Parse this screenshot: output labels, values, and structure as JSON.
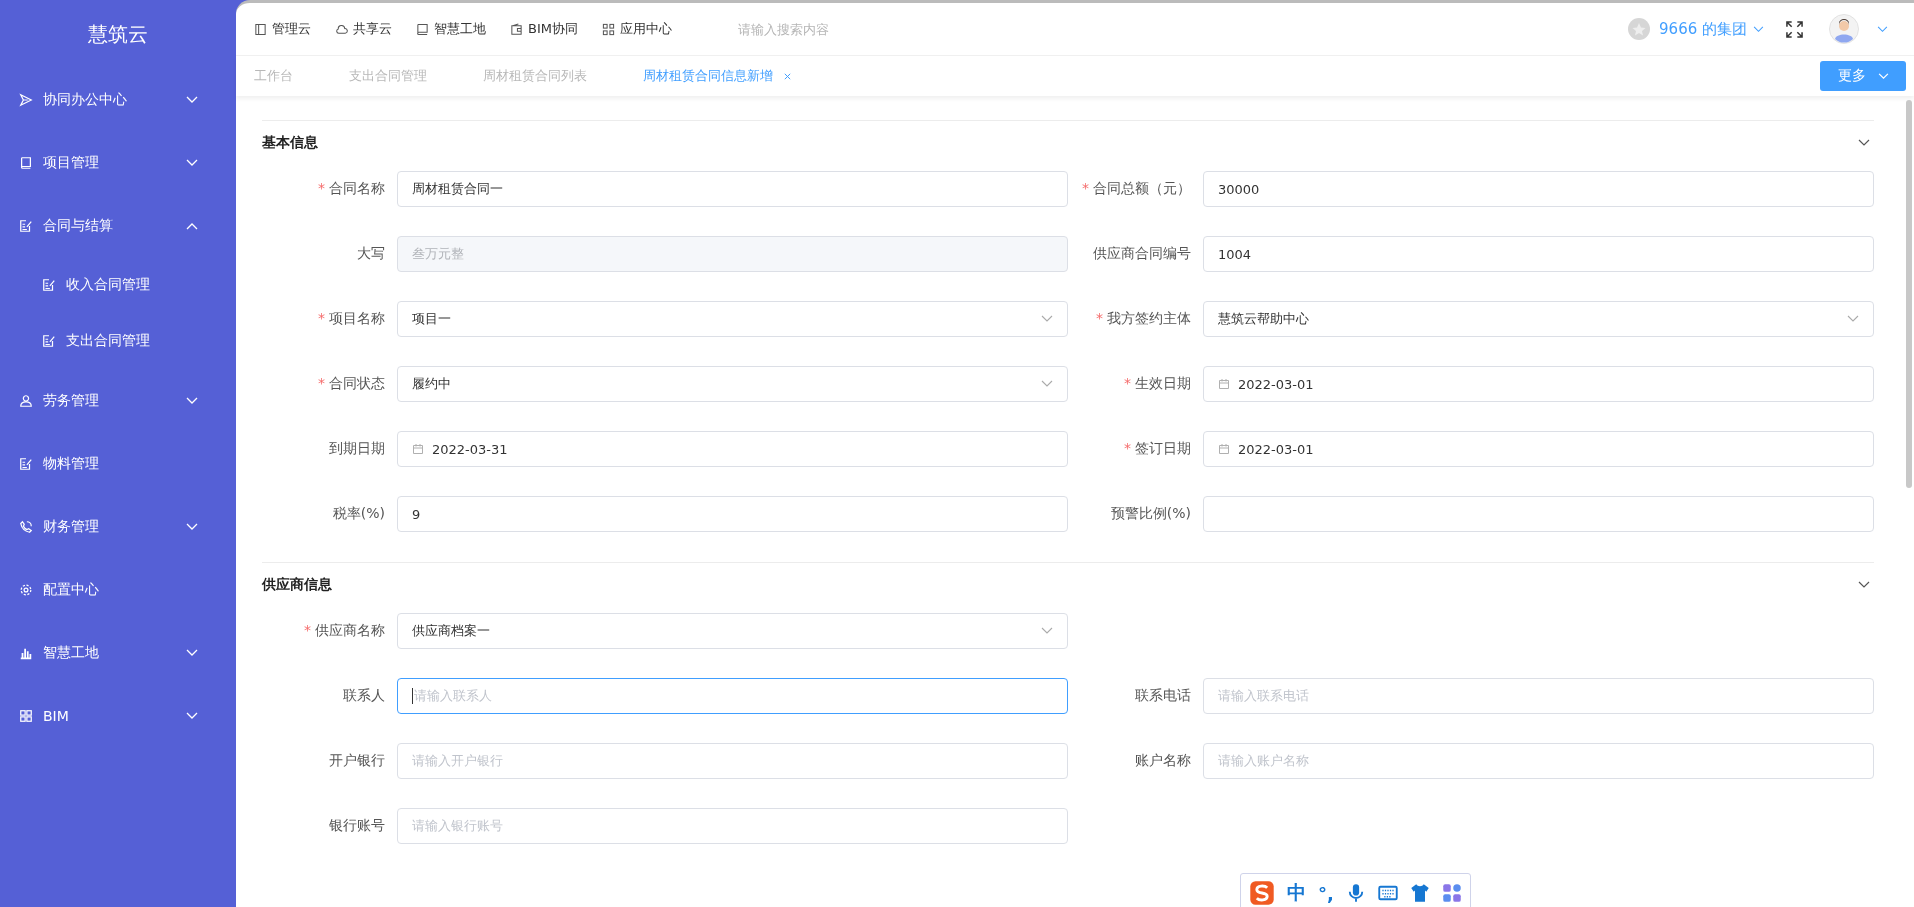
{
  "sidebar": {
    "logo": "慧筑云",
    "items": [
      {
        "label": "协同办公中心",
        "expanded": false
      },
      {
        "label": "项目管理",
        "expanded": false
      },
      {
        "label": "合同与结算",
        "expanded": true,
        "children": [
          {
            "label": "收入合同管理"
          },
          {
            "label": "支出合同管理"
          }
        ]
      },
      {
        "label": "劳务管理",
        "expanded": false
      },
      {
        "label": "物料管理"
      },
      {
        "label": "财务管理",
        "expanded": false
      },
      {
        "label": "配置中心"
      },
      {
        "label": "智慧工地",
        "expanded": false
      },
      {
        "label": "BIM",
        "expanded": false
      }
    ]
  },
  "top_nav": {
    "items": [
      "管理云",
      "共享云",
      "智慧工地",
      "BIM协同",
      "应用中心"
    ],
    "search": {
      "placeholder": "请输入搜索内容"
    },
    "organization": "9666 的集团"
  },
  "tabs": [
    {
      "label": "工作台",
      "selected": false
    },
    {
      "label": "支出合同管理",
      "selected": false
    },
    {
      "label": "周材租赁合同列表",
      "selected": false
    },
    {
      "label": "周材租赁合同信息新增",
      "selected": true
    }
  ],
  "more_button": "更多",
  "sections": [
    {
      "title": "基本信息",
      "rows": [
        [
          {
            "label": "合同名称",
            "required_mark": "*",
            "kind": "text",
            "value": "周材租赁合同一"
          },
          {
            "label": "合同总额（元）",
            "required_mark": "*",
            "kind": "text",
            "value": "30000"
          }
        ],
        [
          {
            "label": "大写",
            "kind": "disabled",
            "value": "叁万元整"
          },
          {
            "label": "供应商合同编号",
            "kind": "text",
            "value": "1004"
          }
        ],
        [
          {
            "label": "项目名称",
            "required_mark": "*",
            "kind": "select",
            "value": "项目一"
          },
          {
            "label": "我方签约主体",
            "required_mark": "*",
            "kind": "select",
            "value": "慧筑云帮助中心"
          }
        ],
        [
          {
            "label": "合同状态",
            "required_mark": "*",
            "kind": "select",
            "value": "履约中"
          },
          {
            "label": "生效日期",
            "required_mark": "*",
            "kind": "date",
            "value": "2022-03-01"
          }
        ],
        [
          {
            "label": "到期日期",
            "kind": "date",
            "value": "2022-03-31"
          },
          {
            "label": "签订日期",
            "required_mark": "*",
            "kind": "date",
            "value": "2022-03-01"
          }
        ],
        [
          {
            "label": "税率(%)",
            "kind": "text",
            "value": "9"
          },
          {
            "label": "预警比例(%)",
            "kind": "text"
          }
        ]
      ]
    },
    {
      "title": "供应商信息",
      "rows": [
        [
          {
            "label": "供应商名称",
            "required_mark": "*",
            "kind": "select",
            "value": "供应商档案一"
          }
        ],
        [
          {
            "label": "联系人",
            "kind": "text",
            "placeholder": "请输入联系人",
            "focused": true
          },
          {
            "label": "联系电话",
            "kind": "text",
            "placeholder": "请输入联系电话"
          }
        ],
        [
          {
            "label": "开户银行",
            "kind": "text",
            "placeholder": "请输入开户银行"
          },
          {
            "label": "账户名称",
            "kind": "text",
            "placeholder": "请输入账户名称"
          }
        ],
        [
          {
            "label": "银行账号",
            "kind": "text",
            "placeholder": "请输入银行账号"
          }
        ]
      ]
    }
  ],
  "ime_toolbar": {
    "mode": "中",
    "punctuation": "°,"
  }
}
